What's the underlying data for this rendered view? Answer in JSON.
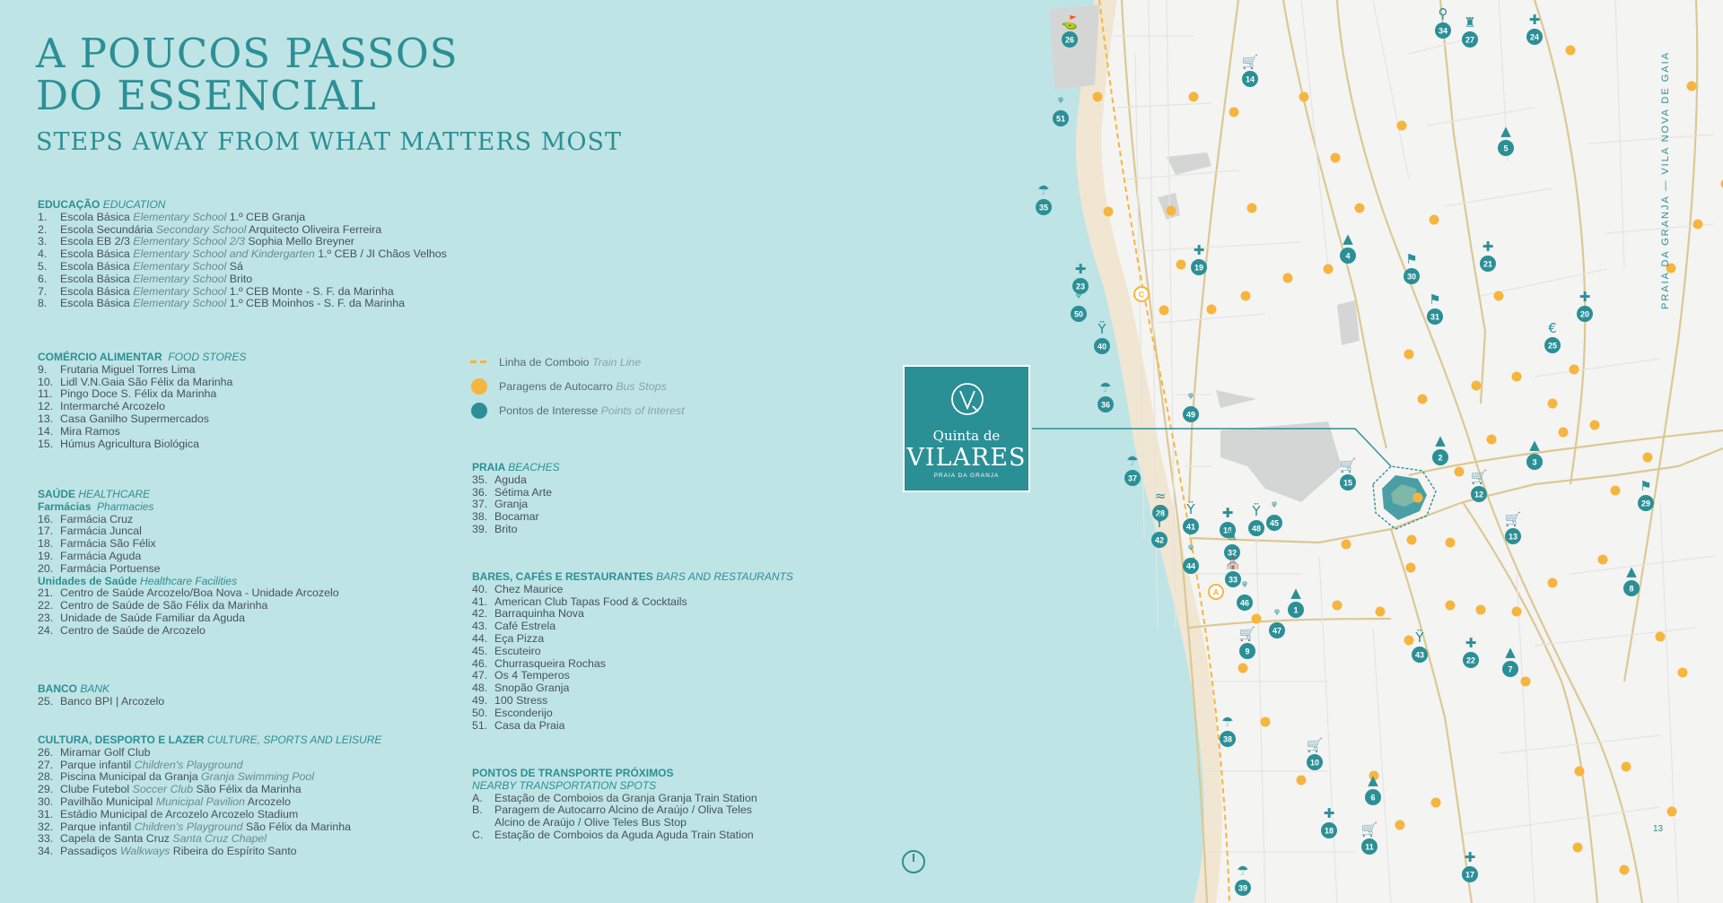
{
  "title_lines": [
    "A POUCOS PASSOS",
    "DO ESSENCIAL"
  ],
  "subtitle": "STEPS AWAY FROM WHAT MATTERS MOST",
  "education": {
    "title_pt": "EDUCAÇÃO",
    "title_en": "EDUCATION",
    "items": [
      {
        "n": "1.",
        "pt": "Escola Básica",
        "en": "Elementary School",
        "name": "1.º CEB Granja"
      },
      {
        "n": "2.",
        "pt": "Escola Secundária",
        "en": "Secondary School",
        "name": "Arquitecto Oliveira Ferreira"
      },
      {
        "n": "3.",
        "pt": "Escola EB 2/3",
        "en": "Elementary School 2/3",
        "name": "Sophia Mello Breyner"
      },
      {
        "n": "4.",
        "pt": "Escola Básica",
        "en": "Elementary School and Kindergarten",
        "name": "1.º CEB / JI Chãos Velhos"
      },
      {
        "n": "5.",
        "pt": "Escola Básica",
        "en": "Elementary School",
        "name": "Sá"
      },
      {
        "n": "6.",
        "pt": "Escola Básica",
        "en": "Elementary School",
        "name": "Brito"
      },
      {
        "n": "7.",
        "pt": "Escola Básica",
        "en": "Elementary School",
        "name": "1.º CEB  Monte - S. F. da Marinha"
      },
      {
        "n": "8.",
        "pt": "Escola Básica",
        "en": "Elementary School",
        "name": "1.º CEB Moinhos - S. F. da Marinha"
      }
    ]
  },
  "food": {
    "title_pt": "COMÉRCIO ALIMENTAR",
    "title_en": "FOOD STORES",
    "items": [
      {
        "n": "9.",
        "t": "Frutaria Miguel Torres Lima"
      },
      {
        "n": "10.",
        "t": "Lidl V.N.Gaia São Félix da Marinha"
      },
      {
        "n": "11.",
        "t": "Pingo Doce S. Félix da Marinha"
      },
      {
        "n": "12.",
        "t": "Intermarché Arcozelo"
      },
      {
        "n": "13.",
        "t": "Casa Ganilho Supermercados"
      },
      {
        "n": "14.",
        "t": "Mira Ramos"
      },
      {
        "n": "15.",
        "t": "Húmus Agricultura Biológica"
      }
    ]
  },
  "health": {
    "title_pt": "SAÚDE",
    "title_en": "HEALTHCARE",
    "pharm_pt": "Farmácias",
    "pharm_en": "Pharmacies",
    "pharmacies": [
      {
        "n": "16.",
        "t": "Farmácia Cruz"
      },
      {
        "n": "17.",
        "t": "Farmácia Juncal"
      },
      {
        "n": "18.",
        "t": "Farmácia São Félix"
      },
      {
        "n": "19.",
        "t": "Farmácia Aguda"
      },
      {
        "n": "20.",
        "t": "Farmácia Portuense"
      }
    ],
    "units_pt": "Unidades de Saúde",
    "units_en": "Healthcare Facilities",
    "units": [
      {
        "n": "21.",
        "t": "Centro de Saúde Arcozelo/Boa Nova - Unidade Arcozelo"
      },
      {
        "n": "22.",
        "t": "Centro de Saúde de São Félix da Marinha"
      },
      {
        "n": "23.",
        "t": "Unidade de Saúde Familiar da Aguda"
      },
      {
        "n": "24.",
        "t": "Centro de Saúde de Arcozelo"
      }
    ]
  },
  "bank": {
    "title_pt": "BANCO",
    "title_en": "BANK",
    "items": [
      {
        "n": "25.",
        "t": "Banco BPI | Arcozelo"
      }
    ]
  },
  "culture": {
    "title_pt": "CULTURA, DESPORTO E LAZER",
    "title_en": "CULTURE, SPORTS AND LEISURE",
    "items": [
      {
        "n": "26.",
        "pt": "Miramar Golf Club",
        "en": "",
        "name": ""
      },
      {
        "n": "27.",
        "pt": "Parque infantil",
        "en": "Children's Playground",
        "name": ""
      },
      {
        "n": "28.",
        "pt": "Piscina Municipal da Granja",
        "en": "Granja Swimming Pool",
        "name": ""
      },
      {
        "n": "29.",
        "pt": "Clube Futebol",
        "en": "Soccer Club",
        "name": "São Félix da Marinha"
      },
      {
        "n": "30.",
        "pt": "Pavilhão Municipal",
        "en": "Municipal Pavilion",
        "name": "Arcozelo"
      },
      {
        "n": "31.",
        "pt": "Estádio Municipal de Arcozelo Arcozelo Stadium",
        "en": "",
        "name": ""
      },
      {
        "n": "32.",
        "pt": "Parque infantil",
        "en": "Children's Playground",
        "name": "São Félix da Marinha"
      },
      {
        "n": "33.",
        "pt": "Capela de Santa Cruz",
        "en": "Santa Cruz Chapel",
        "name": ""
      },
      {
        "n": "34.",
        "pt": "Passadiços",
        "en": "Walkways",
        "name": "Ribeira do Espírito Santo"
      }
    ]
  },
  "legend": {
    "train": {
      "pt": "Linha de Comboio",
      "en": "Train Line"
    },
    "bus": {
      "pt": "Paragens de Autocarro",
      "en": "Bus Stops"
    },
    "poi": {
      "pt": "Pontos de Interesse",
      "en": "Points of Interest"
    }
  },
  "beaches": {
    "title_pt": "PRAIA",
    "title_en": "BEACHES",
    "items": [
      {
        "n": "35.",
        "t": "Aguda"
      },
      {
        "n": "36.",
        "t": "Sétima Arte"
      },
      {
        "n": "37.",
        "t": "Granja"
      },
      {
        "n": "38.",
        "t": "Bocamar"
      },
      {
        "n": "39.",
        "t": "Brito"
      }
    ]
  },
  "bars": {
    "title_pt": "BARES, CAFÉS E RESTAURANTES",
    "title_en": "BARS AND RESTAURANTS",
    "items": [
      {
        "n": "40.",
        "t": "Chez Maurice"
      },
      {
        "n": "41.",
        "t": "American Club Tapas Food & Cocktails"
      },
      {
        "n": "42.",
        "t": "Barraquinha Nova"
      },
      {
        "n": "43.",
        "t": "Café Estrela"
      },
      {
        "n": "44.",
        "t": "Eça Pizza"
      },
      {
        "n": "45.",
        "t": "Escuteiro"
      },
      {
        "n": "46.",
        "t": "Churrasqueira Rochas"
      },
      {
        "n": "47.",
        "t": "Os 4 Temperos"
      },
      {
        "n": "48.",
        "t": "Snopão Granja"
      },
      {
        "n": "49.",
        "t": "100 Stress"
      },
      {
        "n": "50.",
        "t": "Esconderijo"
      },
      {
        "n": "51.",
        "t": "Casa da Praia"
      }
    ]
  },
  "transport": {
    "title_pt": "PONTOS DE TRANSPORTE PRÓXIMOS",
    "title_en": "NEARBY TRANSPORTATION SPOTS",
    "items": [
      {
        "n": "A.",
        "t": "Estação de Comboios da Granja Granja Train Station"
      },
      {
        "n": "B.",
        "t": "Paragem de Autocarro Alcino de Araújo / Oliva Teles"
      },
      {
        "n": "",
        "t": "Alcino de Araújo / Olive Teles Bus Stop"
      },
      {
        "n": "C.",
        "t": "Estação de Comboios da Aguda Aguda Train Station"
      }
    ]
  },
  "logo": {
    "name_line1": "Quinta de",
    "name_line2": "VILARES",
    "tagline": "PRAIA DA GRANJA"
  },
  "vertical_text": "PRAIA DA GRANJA — VILA NOVA DE GAIA",
  "page_number": "13",
  "colors": {
    "teal": "#2b8f96",
    "orange": "#f6b53e",
    "sea": "#bfe4e5",
    "sand": "#f3e6d0",
    "road": "#d9c591"
  },
  "map_markers": [
    {
      "id": "26",
      "icon": "golf-icon"
    },
    {
      "id": "51",
      "icon": "restaurant-icon"
    },
    {
      "id": "14",
      "icon": "cart-icon"
    },
    {
      "id": "34",
      "icon": "walk-icon"
    },
    {
      "id": "27",
      "icon": "playground-icon"
    },
    {
      "id": "24",
      "icon": "cross-icon"
    },
    {
      "id": "5",
      "icon": "school-icon"
    },
    {
      "id": "35",
      "icon": "umbrella-icon"
    },
    {
      "id": "19",
      "icon": "cross-icon"
    },
    {
      "id": "4",
      "icon": "school-icon"
    },
    {
      "id": "30",
      "icon": "run-icon"
    },
    {
      "id": "21",
      "icon": "cross-icon"
    },
    {
      "id": "23",
      "icon": "cross-icon"
    },
    {
      "id": "50",
      "icon": "restaurant-icon"
    },
    {
      "id": "31",
      "icon": "run-icon"
    },
    {
      "id": "20",
      "icon": "cross-icon"
    },
    {
      "id": "40",
      "icon": "cocktail-icon"
    },
    {
      "id": "25",
      "icon": "euro-icon"
    },
    {
      "id": "36",
      "icon": "umbrella-icon"
    },
    {
      "id": "49",
      "icon": "restaurant-icon"
    },
    {
      "id": "2",
      "icon": "school-icon"
    },
    {
      "id": "3",
      "icon": "school-icon"
    },
    {
      "id": "37",
      "icon": "umbrella-icon"
    },
    {
      "id": "15",
      "icon": "cart-icon"
    },
    {
      "id": "12",
      "icon": "cart-icon"
    },
    {
      "id": "29",
      "icon": "run-icon"
    },
    {
      "id": "28",
      "icon": "pool-icon"
    },
    {
      "id": "41",
      "icon": "cocktail-icon"
    },
    {
      "id": "16",
      "icon": "cross-icon"
    },
    {
      "id": "48",
      "icon": "cocktail-icon"
    },
    {
      "id": "45",
      "icon": "restaurant-icon"
    },
    {
      "id": "13",
      "icon": "cart-icon"
    },
    {
      "id": "42",
      "icon": "cocktail-icon"
    },
    {
      "id": "44",
      "icon": "restaurant-icon"
    },
    {
      "id": "32",
      "icon": "playground-icon"
    },
    {
      "id": "33",
      "icon": "chapel-icon"
    },
    {
      "id": "8",
      "icon": "school-icon"
    },
    {
      "id": "46",
      "icon": "restaurant-icon"
    },
    {
      "id": "1",
      "icon": "school-icon"
    },
    {
      "id": "47",
      "icon": "restaurant-icon"
    },
    {
      "id": "9",
      "icon": "cart-icon"
    },
    {
      "id": "43",
      "icon": "cocktail-icon"
    },
    {
      "id": "22",
      "icon": "cross-icon"
    },
    {
      "id": "7",
      "icon": "school-icon"
    },
    {
      "id": "38",
      "icon": "umbrella-icon"
    },
    {
      "id": "10",
      "icon": "cart-icon"
    },
    {
      "id": "6",
      "icon": "school-icon"
    },
    {
      "id": "18",
      "icon": "cross-icon"
    },
    {
      "id": "11",
      "icon": "cart-icon"
    },
    {
      "id": "17",
      "icon": "cross-icon"
    },
    {
      "id": "39",
      "icon": "umbrella-icon"
    }
  ],
  "station_labels": [
    "A",
    "C"
  ]
}
